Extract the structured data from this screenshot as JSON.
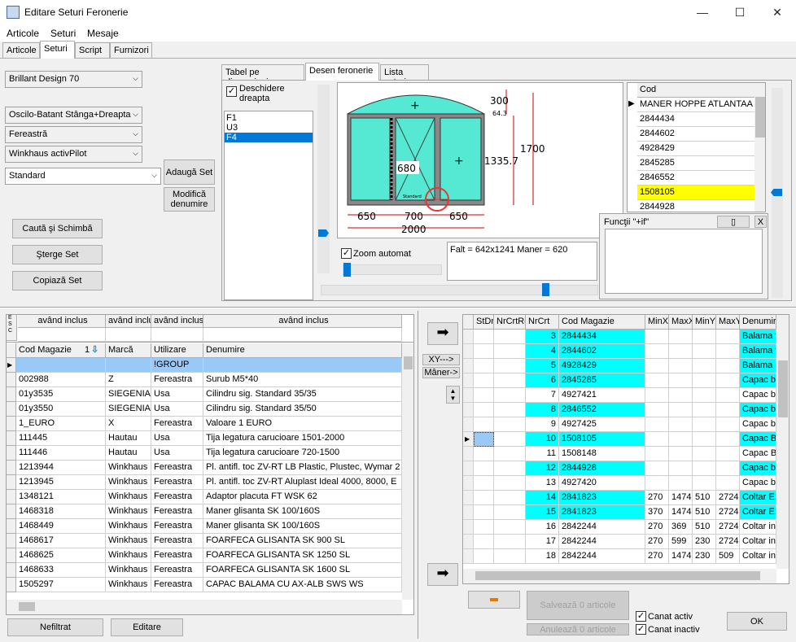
{
  "window": {
    "title": "Editare Seturi Feronerie",
    "min": "—",
    "max": "☐",
    "close": "✕"
  },
  "menu": [
    "Articole",
    "Seturi",
    "Mesaje"
  ],
  "main_tabs": [
    "Articole",
    "Seturi",
    "Script",
    "Furnizori"
  ],
  "left": {
    "profile": "Brillant Design 70",
    "opening": "Oscilo-Batant Stânga+Dreapta",
    "type": "Fereastră",
    "hardware": "Winkhaus activPilot",
    "set": "Standard",
    "add_set": "Adaugă Set",
    "modify_name": "Modifică denumire",
    "search_replace": "Caută şi Schimbă",
    "delete_set": "Şterge Set",
    "copy_set": "Copiază Set"
  },
  "design_tabs": [
    "Tabel pe dimensiuni",
    "Desen feronerie",
    "Lista seturi"
  ],
  "design": {
    "deschidere_label": "Deschidere dreapta",
    "list": [
      "F1",
      "U3",
      "F4"
    ],
    "zoom_label": "Zoom automat",
    "info": "Falt = 642x1241  Maner = 620",
    "dims": {
      "arch_h": "300",
      "arch_sub": "64.3",
      "total_h": "1700",
      "body_h": "1335.7",
      "handle": "680",
      "w1": "650",
      "w2": "700",
      "w3": "650",
      "total_w": "2000",
      "sash_label": "Standard"
    },
    "cod_header": "Cod",
    "cod_list": [
      "MANER HOPPE ATLANTAA",
      "2844434",
      "2844602",
      "4928429",
      "2845285",
      "2846552",
      "1508105",
      "2844928"
    ],
    "functii_label": "Funcţii \"+if\"",
    "functii_btn1": "▯",
    "functii_btn2": "X"
  },
  "articles": {
    "filter_headers": [
      "având inclus",
      "având inclus",
      "având inclus",
      "având inclus"
    ],
    "esc_label": "E S C",
    "col_headers": [
      "Cod Magazie",
      "Marcă",
      "Utilizare",
      "Denumire"
    ],
    "sort_num": "1",
    "rows": [
      [
        "",
        "",
        "!GROUP",
        ""
      ],
      [
        "002988",
        "Z",
        "Fereastra",
        "Surub M5*40"
      ],
      [
        "01y3535",
        "SIEGENIA-",
        "Usa",
        "Cilindru sig. Standard 35/35"
      ],
      [
        "01y3550",
        "SIEGENIA-",
        "Usa",
        "Cilindru sig. Standard 35/50"
      ],
      [
        "1_EURO",
        "X",
        "Fereastra",
        "Valoare 1 EURO"
      ],
      [
        "111445",
        "Hautau",
        "Usa",
        "Tija legatura carucioare 1501-2000"
      ],
      [
        "111446",
        "Hautau",
        "Usa",
        "Tija legatura carucioare 720-1500"
      ],
      [
        "1213944",
        "Winkhaus",
        "Fereastra",
        "Pl. antifl. toc ZV-RT LB Plastic, Plustec, Wymar 2"
      ],
      [
        "1213945",
        "Winkhaus",
        "Fereastra",
        "Pl. antifl. toc ZV-RT Aluplast Ideal 4000, 8000, E"
      ],
      [
        "1348121",
        "Winkhaus",
        "Fereastra",
        "Adaptor placuta FT WSK 62"
      ],
      [
        "1468318",
        "Winkhaus",
        "Fereastra",
        "Maner glisanta SK 100/160S"
      ],
      [
        "1468449",
        "Winkhaus",
        "Fereastra",
        "Maner glisanta SK 100/160S"
      ],
      [
        "1468617",
        "Winkhaus",
        "Fereastra",
        "FOARFECA GLISANTA SK 900 SL"
      ],
      [
        "1468625",
        "Winkhaus",
        "Fereastra",
        "FOARFECA GLISANTA SK 1250 SL"
      ],
      [
        "1468633",
        "Winkhaus",
        "Fereastra",
        "FOARFECA GLISANTA SK 1600 SL"
      ],
      [
        "1505297",
        "Winkhaus",
        "Fereastra",
        "CAPAC BALAMA CU AX-ALB SWS WS"
      ]
    ],
    "unfiltered_btn": "Nefiltrat",
    "edit_btn": "Editare"
  },
  "set_grid": {
    "xy_btn": "XY--->",
    "maner_btn": "Mâner->",
    "headers": [
      "StDr",
      "NrCrtRe",
      "NrCrt",
      "Cod Magazie",
      "MinX",
      "MaxX",
      "MinY",
      "MaxY",
      "Denumire"
    ],
    "rows": [
      {
        "nr": "3",
        "cod": "2844434",
        "minx": "",
        "maxx": "",
        "miny": "",
        "maxy": "",
        "den": "Balama to",
        "hl": true
      },
      {
        "nr": "4",
        "cod": "2844602",
        "minx": "",
        "maxx": "",
        "miny": "",
        "maxy": "",
        "den": "Balama to",
        "hl": true
      },
      {
        "nr": "5",
        "cod": "4928429",
        "minx": "",
        "maxx": "",
        "miny": "",
        "maxy": "",
        "den": "Balama c",
        "hl": true
      },
      {
        "nr": "6",
        "cod": "2845285",
        "minx": "",
        "maxx": "",
        "miny": "",
        "maxy": "",
        "den": "Capac ba",
        "hl": true
      },
      {
        "nr": "7",
        "cod": "4927421",
        "minx": "",
        "maxx": "",
        "miny": "",
        "maxy": "",
        "den": "Capac ba",
        "hl": false
      },
      {
        "nr": "8",
        "cod": "2846552",
        "minx": "",
        "maxx": "",
        "miny": "",
        "maxy": "",
        "den": "Capac ba",
        "hl": true
      },
      {
        "nr": "9",
        "cod": "4927425",
        "minx": "",
        "maxx": "",
        "miny": "",
        "maxy": "",
        "den": "Capac ba",
        "hl": false
      },
      {
        "nr": "10",
        "cod": "1508105",
        "minx": "",
        "maxx": "",
        "miny": "",
        "maxy": "",
        "den": "Capac Ba",
        "hl": true
      },
      {
        "nr": "11",
        "cod": "1508148",
        "minx": "",
        "maxx": "",
        "miny": "",
        "maxy": "",
        "den": "Capac Ba",
        "hl": false
      },
      {
        "nr": "12",
        "cod": "2844928",
        "minx": "",
        "maxx": "",
        "miny": "",
        "maxy": "",
        "den": "Capac ba",
        "hl": true
      },
      {
        "nr": "13",
        "cod": "4927420",
        "minx": "",
        "maxx": "",
        "miny": "",
        "maxy": "",
        "den": "Capac ba",
        "hl": false
      },
      {
        "nr": "14",
        "cod": "2841823",
        "minx": "270",
        "maxx": "1474",
        "miny": "510",
        "maxy": "2724",
        "den": "Coltar E1",
        "hl": true
      },
      {
        "nr": "15",
        "cod": "2841823",
        "minx": "370",
        "maxx": "1474",
        "miny": "510",
        "maxy": "2724",
        "den": "Coltar E1",
        "hl": true
      },
      {
        "nr": "16",
        "cod": "2842244",
        "minx": "270",
        "maxx": "369",
        "miny": "510",
        "maxy": "2724",
        "den": "Coltar ine",
        "hl": false
      },
      {
        "nr": "17",
        "cod": "2842244",
        "minx": "270",
        "maxx": "599",
        "miny": "230",
        "maxy": "2724",
        "den": "Coltar ine",
        "hl": false
      },
      {
        "nr": "18",
        "cod": "2842244",
        "minx": "270",
        "maxx": "1474",
        "miny": "230",
        "maxy": "509",
        "den": "Coltar ine",
        "hl": false
      }
    ],
    "save_btn": "Salvează 0 articole",
    "cancel_btn": "Anulează 0 articole",
    "canat_activ": "Canat activ",
    "canat_inactiv": "Canat inactiv",
    "ok_btn": "OK"
  }
}
